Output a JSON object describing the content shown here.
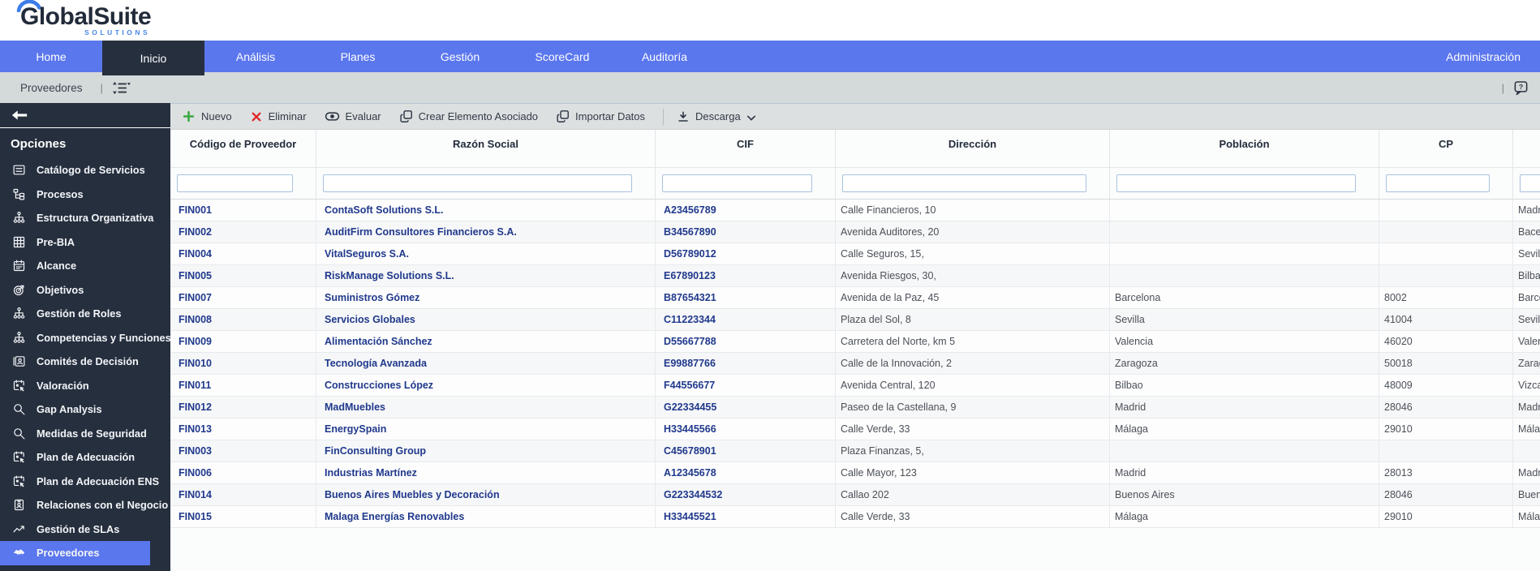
{
  "colors": {
    "nav_blue": "#5b77ee",
    "sidebar_dark": "#262f3e",
    "link_navy": "#20398c",
    "new_green": "#3aa93f",
    "delete_red": "#e12626",
    "logo_blue": "#4a86e8",
    "breadcrumb_gray": "#d4d9da"
  },
  "logo": {
    "title": "GlobalSuite",
    "subtitle": "SOLUTIONS"
  },
  "nav": {
    "tabs": [
      {
        "label": "Home",
        "active": false
      },
      {
        "label": "Inicio",
        "active": true
      },
      {
        "label": "Análisis",
        "active": false
      },
      {
        "label": "Planes",
        "active": false
      },
      {
        "label": "Gestión",
        "active": false
      },
      {
        "label": "ScoreCard",
        "active": false
      },
      {
        "label": "Auditoría",
        "active": false
      }
    ],
    "right_tab": {
      "label": "Administración"
    }
  },
  "breadcrumb": {
    "title": "Proveedores",
    "separator": "|"
  },
  "sidebar": {
    "heading": "Opciones",
    "items": [
      {
        "label": "Catálogo de Servicios",
        "icon": "catalog-icon",
        "selected": false
      },
      {
        "label": "Procesos",
        "icon": "hierarchy-icon",
        "selected": false
      },
      {
        "label": "Estructura Organizativa",
        "icon": "org-chart-icon",
        "selected": false
      },
      {
        "label": "Pre-BIA",
        "icon": "grid-icon",
        "selected": false
      },
      {
        "label": "Alcance",
        "icon": "calendar-icon",
        "selected": false
      },
      {
        "label": "Objetivos",
        "icon": "target-icon",
        "selected": false
      },
      {
        "label": "Gestión de Roles",
        "icon": "org-chart-icon",
        "selected": false
      },
      {
        "label": "Competencias y Funciones",
        "icon": "org-chart-icon",
        "selected": false
      },
      {
        "label": "Comités de Decisión",
        "icon": "id-card-icon",
        "selected": false
      },
      {
        "label": "Valoración",
        "icon": "calendar-cursor-icon",
        "selected": false
      },
      {
        "label": "Gap Analysis",
        "icon": "search-icon",
        "selected": false
      },
      {
        "label": "Medidas de Seguridad",
        "icon": "search-icon",
        "selected": false
      },
      {
        "label": "Plan de Adecuación",
        "icon": "calendar-cursor-icon",
        "selected": false
      },
      {
        "label": "Plan de Adecuación ENS",
        "icon": "calendar-cursor-icon",
        "selected": false
      },
      {
        "label": "Relaciones con el Negocio",
        "icon": "badge-person-icon",
        "selected": false
      },
      {
        "label": "Gestión de SLAs",
        "icon": "trend-chart-icon",
        "selected": false
      },
      {
        "label": "Proveedores",
        "icon": "handshake-icon",
        "selected": true
      }
    ]
  },
  "toolbar": {
    "buttons": [
      {
        "label": "Nuevo",
        "icon": "plus-icon"
      },
      {
        "label": "Eliminar",
        "icon": "x-icon"
      },
      {
        "label": "Evaluar",
        "icon": "evaluate-icon"
      },
      {
        "label": "Crear Elemento Asociado",
        "icon": "copy-icon"
      },
      {
        "label": "Importar Datos",
        "icon": "import-icon"
      }
    ],
    "download": {
      "label": "Descarga"
    }
  },
  "table": {
    "columns": [
      {
        "label": "Código de Proveedor"
      },
      {
        "label": "Razón Social"
      },
      {
        "label": "CIF"
      },
      {
        "label": "Dirección"
      },
      {
        "label": "Población"
      },
      {
        "label": "CP"
      },
      {
        "label": ""
      }
    ],
    "filters": [
      "",
      "",
      "",
      "",
      "",
      "",
      ""
    ],
    "rows": [
      {
        "code": "FIN001",
        "name": "ContaSoft Solutions S.L.",
        "cif": "A23456789",
        "address": "Calle Financieros, 10",
        "city": "",
        "cp": "",
        "extra": "Madr"
      },
      {
        "code": "FIN002",
        "name": "AuditFirm Consultores Financieros S.A.",
        "cif": "B34567890",
        "address": "Avenida Auditores, 20",
        "city": "",
        "cp": "",
        "extra": "Bacel"
      },
      {
        "code": "FIN004",
        "name": "VitalSeguros S.A.",
        "cif": "D56789012",
        "address": "Calle Seguros, 15,",
        "city": "",
        "cp": "",
        "extra": "Sevill"
      },
      {
        "code": "FIN005",
        "name": "RiskManage Solutions S.L.",
        "cif": "E67890123",
        "address": "Avenida Riesgos, 30,",
        "city": "",
        "cp": "",
        "extra": "Bilba"
      },
      {
        "code": "FIN007",
        "name": "Suministros Gómez",
        "cif": "B87654321",
        "address": "Avenida de la Paz, 45",
        "city": "Barcelona",
        "cp": "8002",
        "extra": "Barce"
      },
      {
        "code": "FIN008",
        "name": "Servicios Globales",
        "cif": "C11223344",
        "address": "Plaza del Sol, 8",
        "city": "Sevilla",
        "cp": "41004",
        "extra": "Sevill"
      },
      {
        "code": "FIN009",
        "name": "Alimentación Sánchez",
        "cif": "D55667788",
        "address": "Carretera del Norte, km 5",
        "city": "Valencia",
        "cp": "46020",
        "extra": "Valen"
      },
      {
        "code": "FIN010",
        "name": "Tecnología Avanzada",
        "cif": "E99887766",
        "address": "Calle de la Innovación, 2",
        "city": "Zaragoza",
        "cp": "50018",
        "extra": "Zarag"
      },
      {
        "code": "FIN011",
        "name": "Construcciones López",
        "cif": "F44556677",
        "address": "Avenida Central, 120",
        "city": "Bilbao",
        "cp": "48009",
        "extra": "Vizca"
      },
      {
        "code": "FIN012",
        "name": "MadMuebles",
        "cif": "G22334455",
        "address": "Paseo de la Castellana, 9",
        "city": "Madrid",
        "cp": "28046",
        "extra": "Madr"
      },
      {
        "code": "FIN013",
        "name": "EnergySpain",
        "cif": "H33445566",
        "address": "Calle Verde, 33",
        "city": "Málaga",
        "cp": "29010",
        "extra": "Málag"
      },
      {
        "code": "FIN003",
        "name": "FinConsulting Group",
        "cif": "C45678901",
        "address": "Plaza Finanzas, 5,",
        "city": "",
        "cp": "",
        "extra": ""
      },
      {
        "code": "FIN006",
        "name": "Industrias Martínez",
        "cif": "A12345678",
        "address": "Calle Mayor, 123",
        "city": "Madrid",
        "cp": "28013",
        "extra": "Madr"
      },
      {
        "code": "FIN014",
        "name": "Buenos Aires Muebles y Decoración",
        "cif": "G223344532",
        "address": "Callao 202",
        "city": "Buenos Aires",
        "cp": "28046",
        "extra": "Buen"
      },
      {
        "code": "FIN015",
        "name": "Malaga Energías Renovables",
        "cif": "H33445521",
        "address": "Calle Verde, 33",
        "city": "Málaga",
        "cp": "29010",
        "extra": "Málag"
      }
    ]
  }
}
